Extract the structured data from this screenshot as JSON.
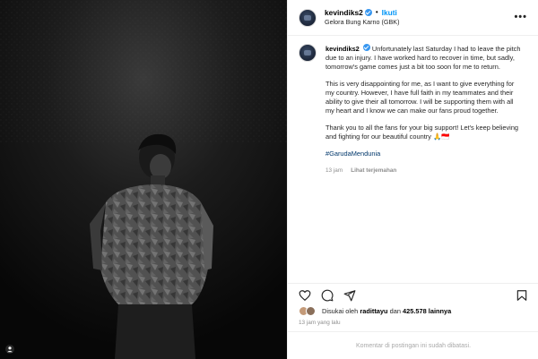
{
  "post": {
    "username": "kevindiks2",
    "follow_label": "Ikuti",
    "separator": "•",
    "location": "Gelora Bung Karno (GBK)",
    "more_label": "•••"
  },
  "caption": {
    "username": "kevindiks2",
    "paragraph1": "Unfortunately last Saturday I had to leave the pitch due to an injury. I have worked hard to recover in time, but sadly, tomorrow's game comes just a bit too soon for me to return.",
    "paragraph2": "This is very disappointing for me, as I want to give everything for my country. However, I have full faith in my teammates and their ability to give their all tomorrow. I will be supporting them with all my heart and I know we can make our fans proud together.",
    "paragraph3": "Thank you to all the fans for your big support! Let's keep believing and fighting for our beautiful country 🙏🇮🇩",
    "hashtag": "#GarudaMendunia",
    "time": "13 jam",
    "translate_label": "Lihat terjemahan"
  },
  "likes": {
    "prefix": "Disukai oleh",
    "user": "radittayu",
    "conjunction": "dan",
    "count": "425.578 lainnya"
  },
  "timestamp": "13 jam yang lalu",
  "comments_off": "Komentar di postingan ini sudah dibatasi.",
  "icons": {
    "like": "heart-icon",
    "comment": "comment-icon",
    "share": "share-icon",
    "save": "bookmark-icon",
    "verified": "verified-badge-icon",
    "more": "more-options-icon"
  },
  "colors": {
    "follow": "#0095f6",
    "hashtag": "#00376b",
    "verified": "#3897f0",
    "muted": "#8e8e8e"
  }
}
